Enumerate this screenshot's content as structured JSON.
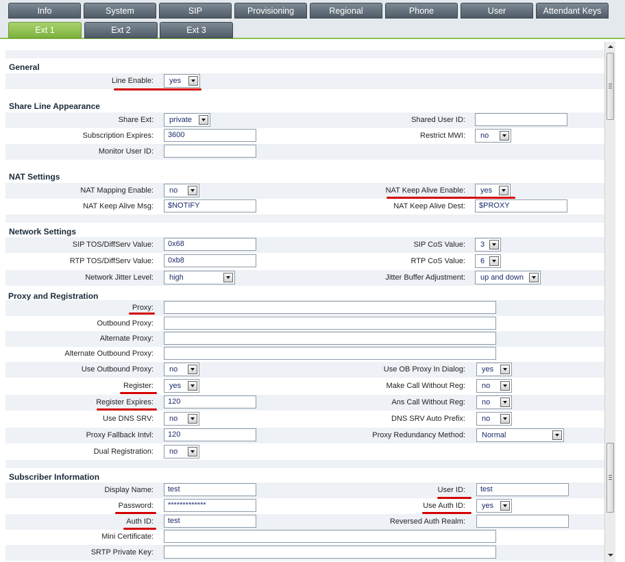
{
  "top_tabs": [
    "Info",
    "System",
    "SIP",
    "Provisioning",
    "Regional",
    "Phone",
    "User",
    "Attendant Keys"
  ],
  "sub_tabs": [
    "Ext 1",
    "Ext 2",
    "Ext 3"
  ],
  "active_sub_tab": "Ext 1",
  "sections": {
    "general": "General",
    "share_line": "Share Line Appearance",
    "nat": "NAT Settings",
    "network": "Network Settings",
    "proxy": "Proxy and Registration",
    "subscriber": "Subscriber Information"
  },
  "fields": {
    "line_enable": {
      "label": "Line Enable:",
      "value": "yes"
    },
    "share_ext": {
      "label": "Share Ext:",
      "value": "private"
    },
    "shared_user_id": {
      "label": "Shared User ID:",
      "value": ""
    },
    "subscription_expires": {
      "label": "Subscription Expires:",
      "value": "3600"
    },
    "restrict_mwi": {
      "label": "Restrict MWI:",
      "value": "no"
    },
    "monitor_user_id": {
      "label": "Monitor User ID:",
      "value": ""
    },
    "nat_mapping_enable": {
      "label": "NAT Mapping Enable:",
      "value": "no"
    },
    "nat_keep_alive_enable": {
      "label": "NAT Keep Alive Enable:",
      "value": "yes"
    },
    "nat_keep_alive_msg": {
      "label": "NAT Keep Alive Msg:",
      "value": "$NOTIFY"
    },
    "nat_keep_alive_dest": {
      "label": "NAT Keep Alive Dest:",
      "value": "$PROXY"
    },
    "sip_tos": {
      "label": "SIP TOS/DiffServ Value:",
      "value": "0x68"
    },
    "sip_cos": {
      "label": "SIP CoS Value:",
      "value": "3"
    },
    "rtp_tos": {
      "label": "RTP TOS/DiffServ Value:",
      "value": "0xb8"
    },
    "rtp_cos": {
      "label": "RTP CoS Value:",
      "value": "6"
    },
    "network_jitter": {
      "label": "Network Jitter Level:",
      "value": "high"
    },
    "jitter_buffer": {
      "label": "Jitter Buffer Adjustment:",
      "value": "up and down"
    },
    "proxy": {
      "label": "Proxy:",
      "value": ""
    },
    "outbound_proxy": {
      "label": "Outbound Proxy:",
      "value": ""
    },
    "alternate_proxy": {
      "label": "Alternate Proxy:",
      "value": ""
    },
    "alt_outbound_proxy": {
      "label": "Alternate Outbound Proxy:",
      "value": ""
    },
    "use_outbound_proxy": {
      "label": "Use Outbound Proxy:",
      "value": "no"
    },
    "use_ob_proxy_dialog": {
      "label": "Use OB Proxy In Dialog:",
      "value": "yes"
    },
    "register": {
      "label": "Register:",
      "value": "yes"
    },
    "make_call_without_reg": {
      "label": "Make Call Without Reg:",
      "value": "no"
    },
    "register_expires": {
      "label": "Register Expires:",
      "value": "120"
    },
    "ans_call_without_reg": {
      "label": "Ans Call Without Reg:",
      "value": "no"
    },
    "use_dns_srv": {
      "label": "Use DNS SRV:",
      "value": "no"
    },
    "dns_srv_auto_prefix": {
      "label": "DNS SRV Auto Prefix:",
      "value": "no"
    },
    "proxy_fallback": {
      "label": "Proxy Fallback Intvl:",
      "value": "120"
    },
    "proxy_redundancy": {
      "label": "Proxy Redundancy Method:",
      "value": "Normal"
    },
    "dual_registration": {
      "label": "Dual Registration:",
      "value": "no"
    },
    "display_name": {
      "label": "Display Name:",
      "value": "test"
    },
    "user_id": {
      "label": "User ID:",
      "value": "test"
    },
    "password": {
      "label": "Password:",
      "value": "*************"
    },
    "use_auth_id": {
      "label": "Use Auth ID:",
      "value": "yes"
    },
    "auth_id": {
      "label": "Auth ID:",
      "value": "test"
    },
    "reversed_auth_realm": {
      "label": "Reversed Auth Realm:",
      "value": ""
    },
    "mini_certificate": {
      "label": "Mini Certificate:",
      "value": ""
    },
    "srtp_private_key": {
      "label": "SRTP Private Key:",
      "value": ""
    }
  },
  "colors": {
    "active_tab": "#8cc04e",
    "tab": "#5d6973",
    "highlight_mark": "#d40000",
    "row_alt": "#eef1f5"
  }
}
